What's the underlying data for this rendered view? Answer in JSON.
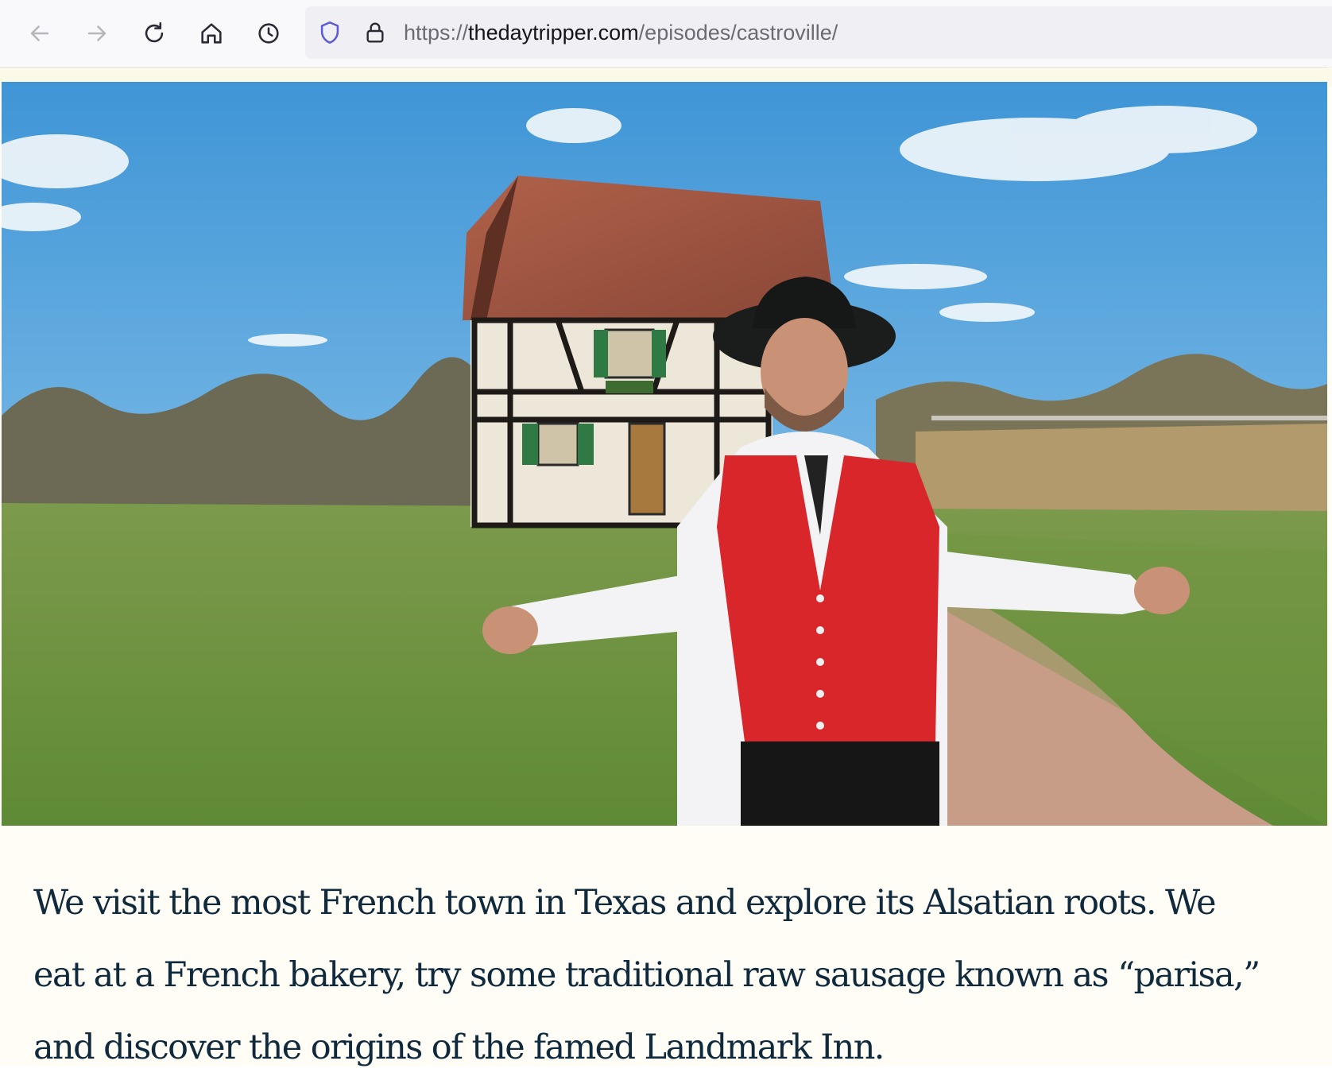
{
  "browser": {
    "url_scheme": "https://",
    "url_domain": "thedaytripper.com",
    "url_path": "/episodes/castroville/",
    "icons": {
      "back": "arrow-left-icon",
      "forward": "arrow-right-icon",
      "reload": "reload-icon",
      "home": "home-icon",
      "history": "clock-icon",
      "tracking": "shield-icon",
      "security": "lock-icon"
    }
  },
  "hero": {
    "image": "castroville-alsatian-house-host"
  },
  "article": {
    "description": "We visit the most French town in Texas and explore its Alsatian roots.  We eat at a French bakery, try some traditional raw sausage known as “parisa,” and discover the origins of the famed Landmark Inn."
  },
  "colors": {
    "text": "#0f2a3d",
    "page_background": "#fffdf6",
    "toolbar": "#f9f9fb",
    "shield": "#5b5bd6"
  }
}
